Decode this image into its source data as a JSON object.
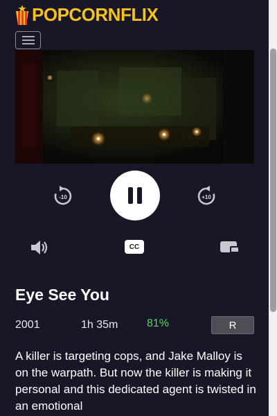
{
  "header": {
    "logo_text": "POPCORNFLIX",
    "brand_color": "#f7c21a",
    "menu_icon": "hamburger-menu-icon"
  },
  "player": {
    "rewind_label": "-10",
    "forward_label": "+10",
    "state_icon": "pause-icon",
    "cc_label": "CC",
    "volume_icon": "volume-icon",
    "pip_icon": "picture-in-picture-icon"
  },
  "movie": {
    "title": "Eye See You",
    "year": "2001",
    "duration": "1h 35m",
    "score": "81%",
    "score_color": "#5fd35f",
    "rating": "R",
    "description": "A killer is targeting cops, and Jake Malloy is on the warpath. But now the killer is making it personal and this dedicated agent is twisted in an emotional"
  }
}
